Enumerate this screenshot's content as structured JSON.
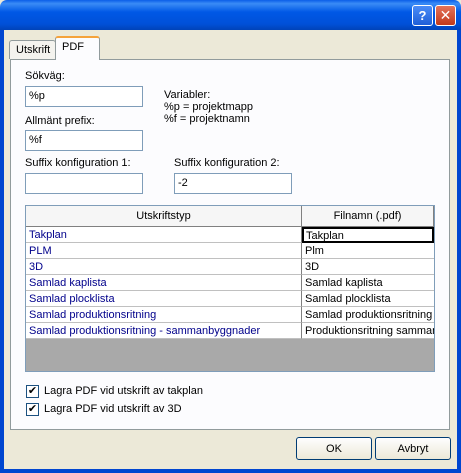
{
  "window": {
    "help_icon": "question-mark-icon",
    "help_glyph": "?",
    "close_icon": "close-x-icon",
    "close_glyph": "✕"
  },
  "tabs": [
    {
      "label": "Utskrift",
      "selected": false
    },
    {
      "label": "PDF",
      "selected": true
    }
  ],
  "form": {
    "path_label": "Sökväg:",
    "path_value": "%p",
    "prefix_label": "Allmänt prefix:",
    "prefix_value": "%f",
    "vars_title": "Variabler:",
    "vars_line1": "%p = projektmapp",
    "vars_line2": "%f = projektnamn",
    "suffix1_label": "Suffix konfiguration 1:",
    "suffix1_value": "",
    "suffix2_label": "Suffix konfiguration 2:",
    "suffix2_value": "-2"
  },
  "grid": {
    "col1": "Utskriftstyp",
    "col2": "Filnamn (.pdf)",
    "rows": [
      {
        "type": "Takplan",
        "file": "Takplan"
      },
      {
        "type": "PLM",
        "file": "Plm"
      },
      {
        "type": "3D",
        "file": "3D"
      },
      {
        "type": "Samlad kaplista",
        "file": "Samlad kaplista"
      },
      {
        "type": "Samlad plocklista",
        "file": "Samlad plocklista"
      },
      {
        "type": "Samlad produktionsritning",
        "file": "Samlad produktionsritning"
      },
      {
        "type": "Samlad produktionsritning - sammanbyggnader",
        "file": "Produktionsritning samman"
      }
    ]
  },
  "options": {
    "save_takplan_label": "Lagra PDF vid utskrift av takplan",
    "save_takplan_checked": true,
    "save_3d_label": "Lagra PDF vid utskrift av 3D",
    "save_3d_checked": true,
    "check_glyph": "✔"
  },
  "buttons": {
    "ok": "OK",
    "cancel": "Avbryt"
  }
}
